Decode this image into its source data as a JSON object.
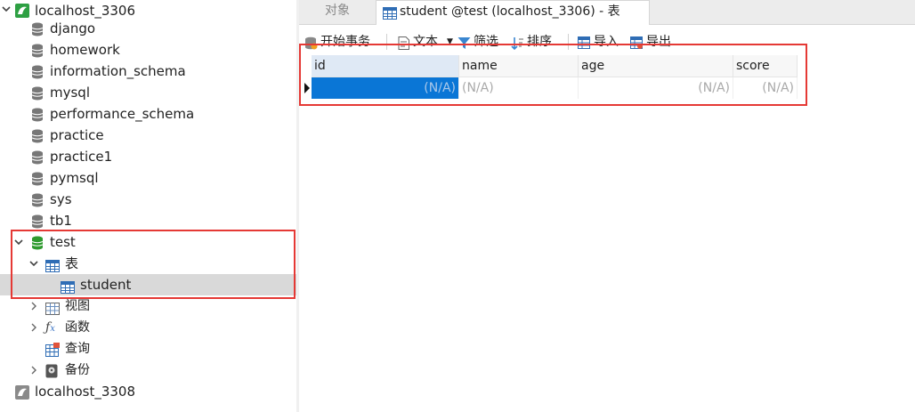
{
  "sidebar": {
    "connection_top": "localhost_3306",
    "databases": [
      "django",
      "homework",
      "information_schema",
      "mysql",
      "performance_schema",
      "practice",
      "practice1",
      "pymsql",
      "sys",
      "tb1"
    ],
    "active_db": "test",
    "tables_group": "表",
    "table_item": "student",
    "views": "视图",
    "functions": "函数",
    "queries": "查询",
    "backups": "备份",
    "connection_bottom": "localhost_3308"
  },
  "tabs": {
    "objects": "对象",
    "active": "student @test (localhost_3306) - 表"
  },
  "toolbar": {
    "begin_txn": "开始事务",
    "text": "文本",
    "filter": "筛选",
    "sort": "排序",
    "import": "导入",
    "export": "导出"
  },
  "grid": {
    "columns": [
      "id",
      "name",
      "age",
      "score"
    ],
    "row": [
      "(N/A)",
      "(N/A)",
      "(N/A)",
      "(N/A)"
    ]
  },
  "colors": {
    "highlight": "#e53935",
    "selection": "#0a76d6",
    "db_active": "#2e9a2e"
  }
}
